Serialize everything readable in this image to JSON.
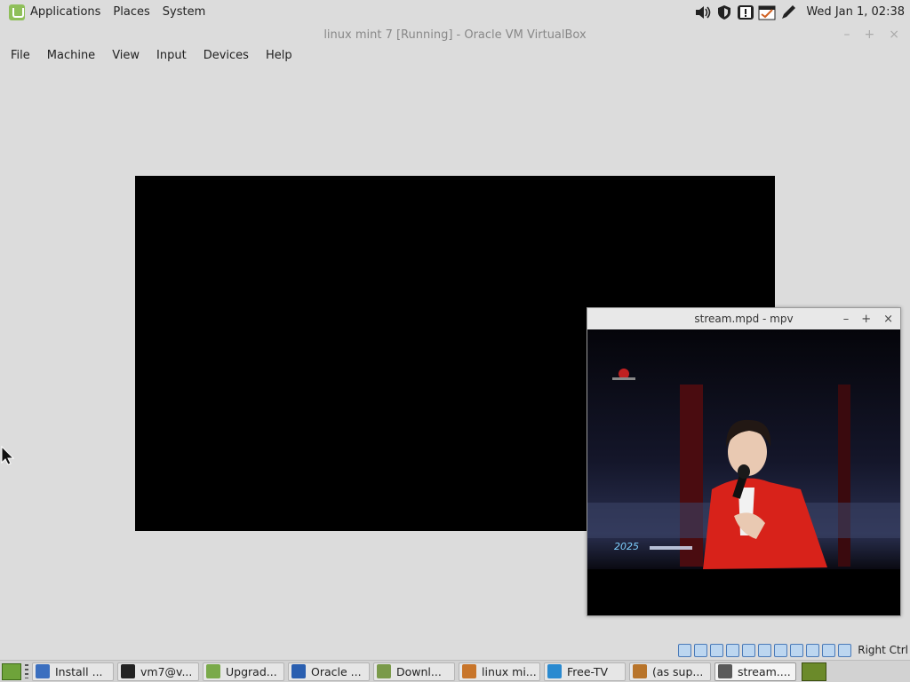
{
  "top_panel": {
    "menu": [
      "Applications",
      "Places",
      "System"
    ],
    "clock": "Wed Jan  1, 02:38"
  },
  "vbox": {
    "title": "linux mint 7 [Running] - Oracle VM VirtualBox",
    "menu": [
      "File",
      "Machine",
      "View",
      "Input",
      "Devices",
      "Help"
    ],
    "host_key": "Right Ctrl"
  },
  "mpv": {
    "title": "stream.mpd - mpv"
  },
  "taskbar": {
    "tasks": [
      {
        "label": "Install ...",
        "icon": "installer-icon",
        "color": "#3b6fbf"
      },
      {
        "label": "vm7@v...",
        "icon": "terminal-icon",
        "color": "#222222"
      },
      {
        "label": "Upgrad...",
        "icon": "update-shield-icon",
        "color": "#7aaa4a"
      },
      {
        "label": "Oracle ...",
        "icon": "virtualbox-icon",
        "color": "#2a5fb0"
      },
      {
        "label": "Downl...",
        "icon": "folder-icon",
        "color": "#7a9a4a"
      },
      {
        "label": "linux mi...",
        "icon": "vm-window-icon",
        "color": "#c8752a"
      },
      {
        "label": "Free-TV",
        "icon": "freetv-icon",
        "color": "#2a8ad0"
      },
      {
        "label": "(as sup...",
        "icon": "editor-icon",
        "color": "#b8742a"
      },
      {
        "label": "stream....",
        "icon": "mpv-window-icon",
        "color": "#5a5a5a"
      }
    ]
  }
}
